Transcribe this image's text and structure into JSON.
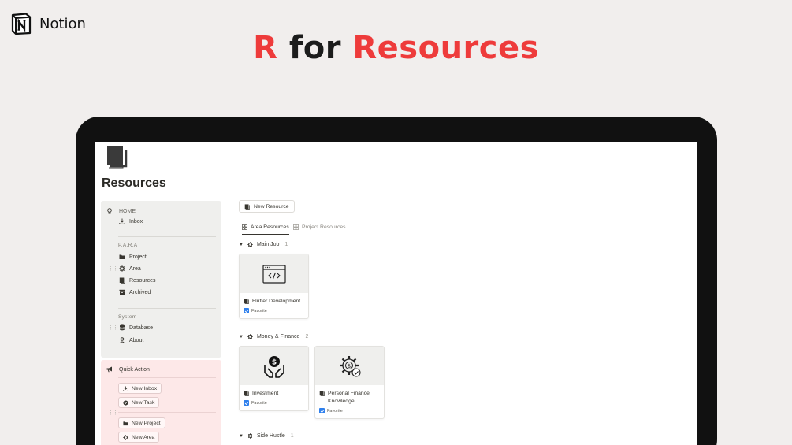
{
  "brand": {
    "name": "Notion",
    "logo_icon": "notion-logo-icon"
  },
  "headline": {
    "part1": "R",
    "part2": "for",
    "part3": "Resources",
    "accent_color": "#ee3b3b"
  },
  "page": {
    "title": "Resources",
    "icon": "resources-page-icon"
  },
  "sidebar": {
    "home_label": "HOME",
    "inbox_label": "Inbox",
    "para_label": "P.A.R.A",
    "project_label": "Project",
    "area_label": "Area",
    "resources_label": "Resources",
    "archived_label": "Archived",
    "system_label": "System",
    "database_label": "Database",
    "about_label": "About"
  },
  "quick_action": {
    "title": "Quick Action",
    "new_inbox": "New Inbox",
    "new_task": "New Task",
    "new_project": "New Project",
    "new_area": "New Area"
  },
  "content": {
    "new_button": "New Resource",
    "tabs": [
      {
        "label": "Area Resources",
        "active": true
      },
      {
        "label": "Project Resources",
        "active": false
      }
    ],
    "groups": [
      {
        "name": "Main Job",
        "count": "1",
        "cards": [
          {
            "title": "Flutter Development",
            "favorite_label": "Favorite",
            "image_icon": "code-window-icon"
          }
        ]
      },
      {
        "name": "Money & Finance",
        "count": "2",
        "cards": [
          {
            "title": "Investment",
            "favorite_label": "Favorite",
            "image_icon": "hands-dollar-icon"
          },
          {
            "title": "Personal Finance Knowledge",
            "favorite_label": "Favorite",
            "image_icon": "gear-dollar-icon"
          }
        ]
      },
      {
        "name": "Side Hustle",
        "count": "1",
        "cards": []
      }
    ]
  }
}
